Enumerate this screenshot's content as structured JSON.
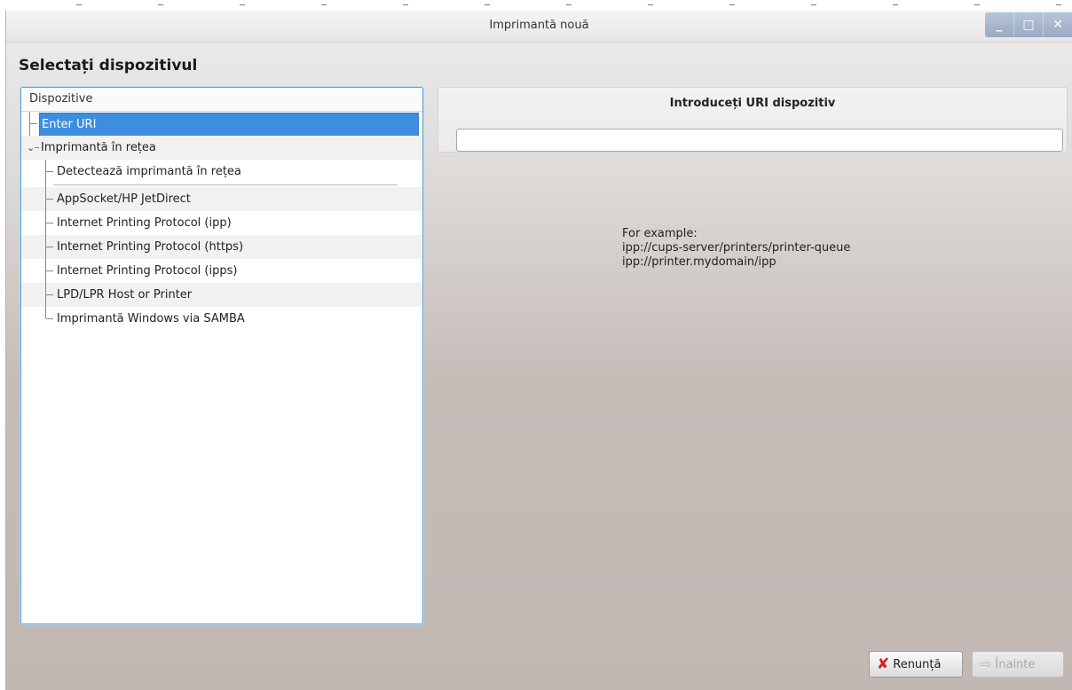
{
  "window": {
    "title": "Imprimantă nouă",
    "controls": {
      "minimize": "_",
      "maximize": "□",
      "close": "✕"
    }
  },
  "heading": "Selectați dispozitivul",
  "device_tree": {
    "header": "Dispozitive",
    "items": [
      {
        "label": "Enter URI",
        "selected": true
      },
      {
        "label": "Imprimantă în rețea",
        "expanded": true,
        "toggle": "⌄"
      },
      {
        "label": "Detectează imprimantă în rețea"
      },
      {
        "label": "AppSocket/HP JetDirect"
      },
      {
        "label": "Internet Printing Protocol (ipp)"
      },
      {
        "label": "Internet Printing Protocol (https)"
      },
      {
        "label": "Internet Printing Protocol (ipps)"
      },
      {
        "label": "LPD/LPR Host or Printer"
      },
      {
        "label": "Imprimantă Windows via SAMBA"
      }
    ]
  },
  "uri_panel": {
    "title": "Introduceți URI dispozitiv",
    "uri_value": "",
    "example_lines": [
      "For example:",
      "ipp://cups-server/printers/printer-queue",
      "ipp://printer.mydomain/ipp"
    ]
  },
  "buttons": {
    "cancel": {
      "label": "Renunță",
      "icon": "x-icon"
    },
    "forward": {
      "label": "Înainte",
      "icon": "arrow-right-icon",
      "disabled": true
    }
  },
  "colors": {
    "selection": "#3d8ee0",
    "focus_border": "#5aa2d6",
    "cancel_icon": "#d62020"
  }
}
